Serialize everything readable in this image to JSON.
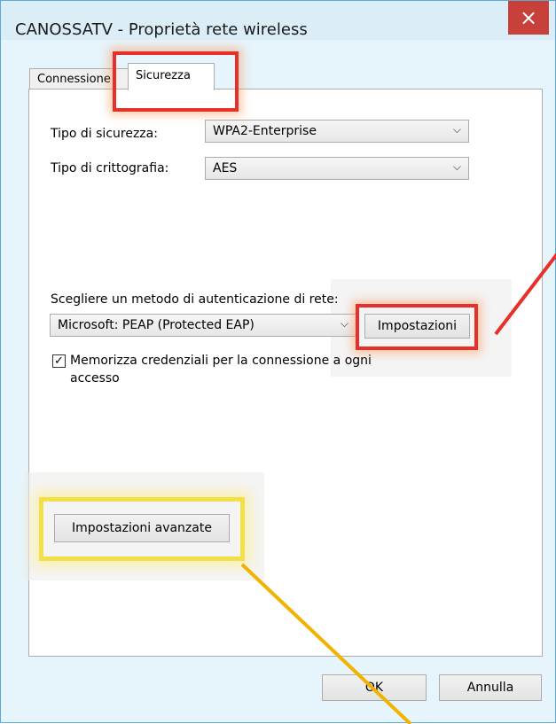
{
  "window": {
    "title": "CANOSSATV - Proprietà rete wireless",
    "close_glyph": "×"
  },
  "tabs": [
    {
      "label": "Connessione",
      "active": false
    },
    {
      "label": "Sicurezza",
      "active": true
    }
  ],
  "security": {
    "type_label": "Tipo di sicurezza:",
    "type_value": "WPA2-Enterprise",
    "encryption_label": "Tipo di crittografia:",
    "encryption_value": "AES",
    "auth_method_label": "Scegliere un metodo di autenticazione di rete:",
    "auth_method_value": "Microsoft: PEAP (Protected EAP)",
    "settings_button": "Impostazioni",
    "remember_checked": true,
    "remember_label_line1": "Memorizza credenziali per la connessione a ogni",
    "remember_label_line2": "accesso",
    "advanced_button": "Impostazioni avanzate"
  },
  "footer": {
    "ok_button": "OK",
    "cancel_button": "Annulla"
  },
  "annotation_colors": {
    "red": "#e8302a",
    "yellow": "#f3e048",
    "orange_arrow": "#f2b300"
  }
}
